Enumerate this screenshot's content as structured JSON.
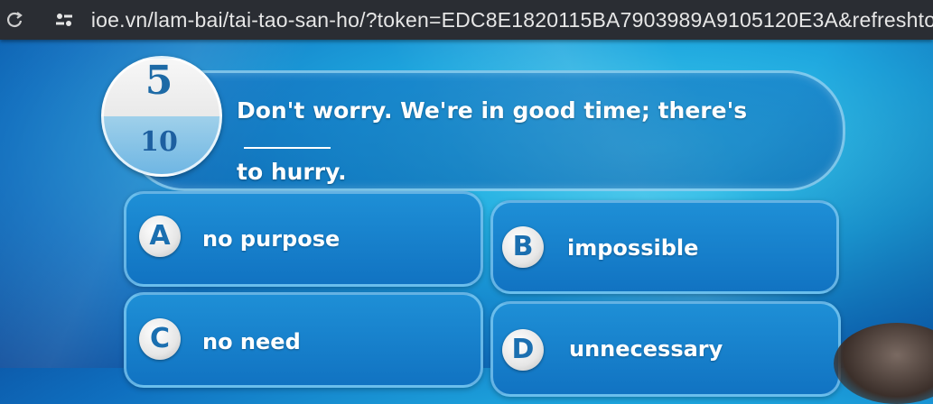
{
  "browser": {
    "url": "ioe.vn/lam-bai/tai-tao-san-ho/?token=EDC8E1820115BA7903989A9105120E3A&refreshtoken=&ex",
    "icons": [
      "reload-icon",
      "site-settings-icon"
    ]
  },
  "quiz": {
    "counter": {
      "current": "5",
      "total": "10"
    },
    "question": {
      "line1": "Don't worry. We're in good time; there's",
      "line2": "to hurry."
    },
    "answers": [
      {
        "letter": "A",
        "text": "no purpose"
      },
      {
        "letter": "B",
        "text": "impossible"
      },
      {
        "letter": "C",
        "text": "no need"
      },
      {
        "letter": "D",
        "text": "unnecessary"
      }
    ]
  },
  "colors": {
    "background": "#1ea6de",
    "card": "#1173c2",
    "counter_text": "#1d6aa6"
  }
}
